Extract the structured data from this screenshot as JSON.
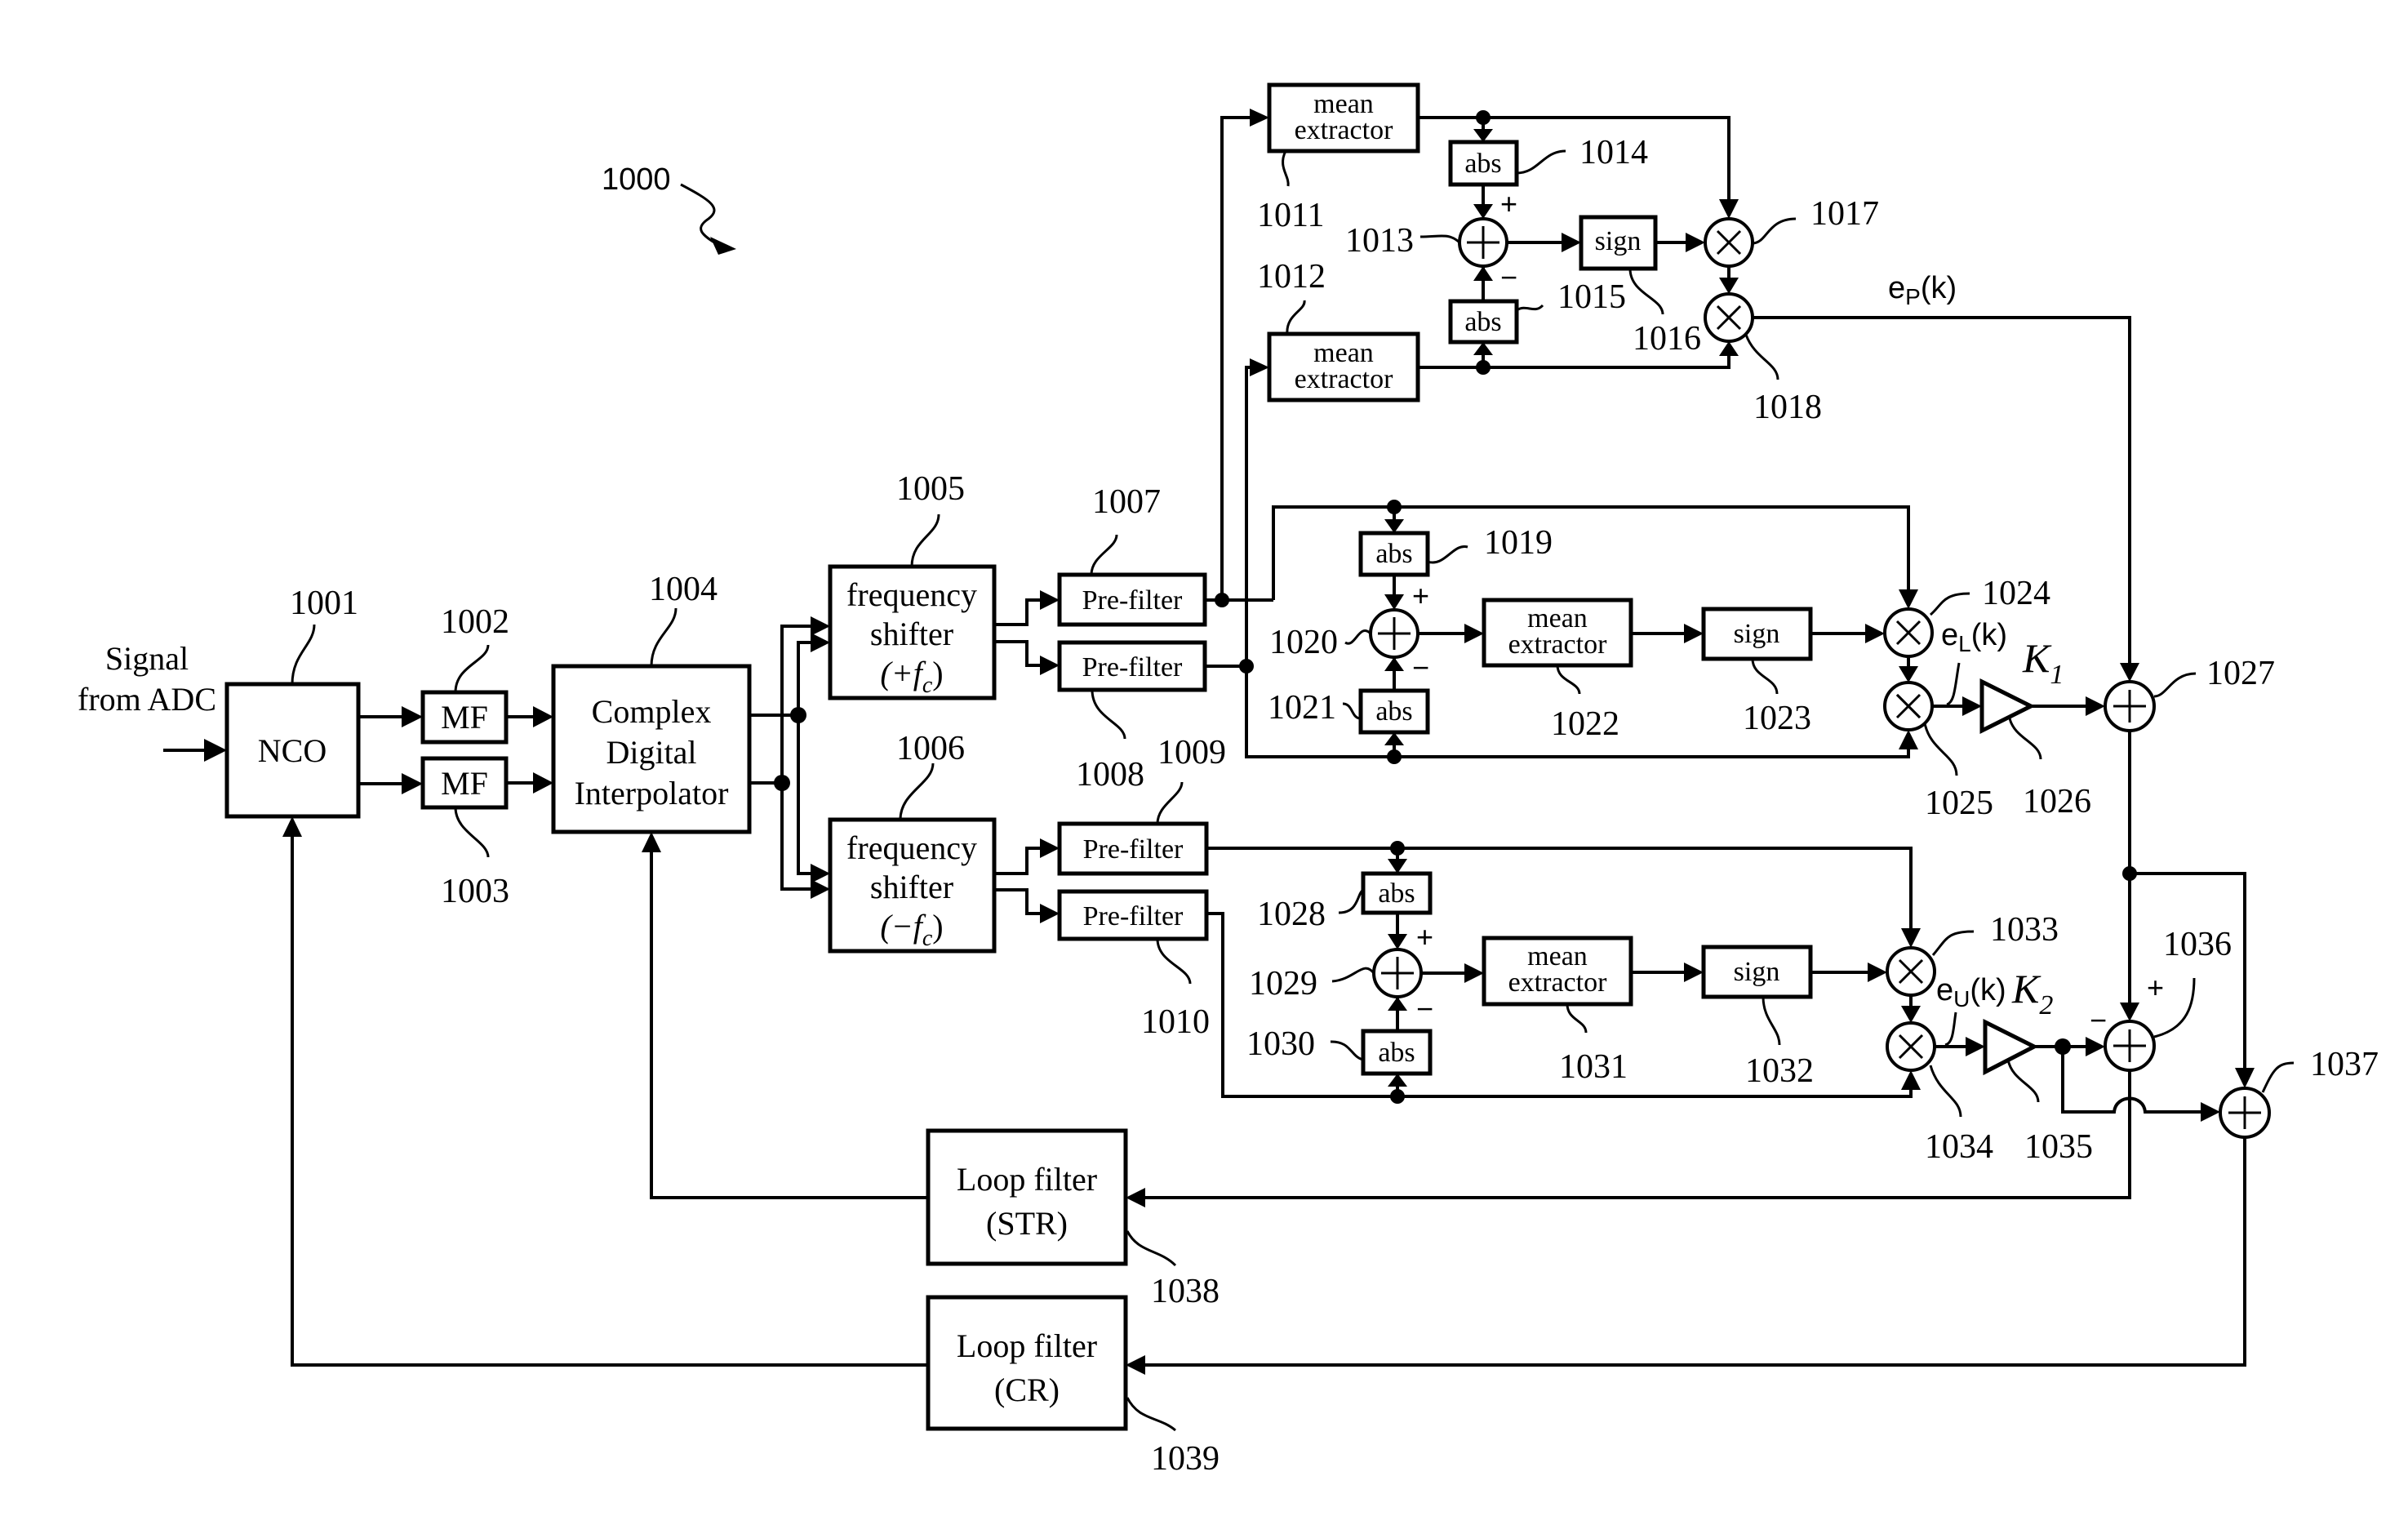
{
  "figure": {
    "id_label": "1000",
    "input_label_line1": "Signal",
    "input_label_line2": "from ADC"
  },
  "blocks": {
    "nco": {
      "ref": "1001",
      "label": "NCO"
    },
    "mf_top": {
      "ref": "1002",
      "label": "MF"
    },
    "mf_bottom": {
      "ref": "1003",
      "label": "MF"
    },
    "interpolator": {
      "ref": "1004",
      "line1": "Complex",
      "line2": "Digital",
      "line3": "Interpolator"
    },
    "freq_shifter_pos": {
      "ref": "1005",
      "line1": "frequency",
      "line2": "shifter",
      "line3": "(+f",
      "sub": "c",
      "close": ")"
    },
    "freq_shifter_neg": {
      "ref": "1006",
      "line1": "frequency",
      "line2": "shifter",
      "line3": "(−f",
      "sub": "c",
      "close": ")"
    },
    "prefilter_1007": {
      "ref": "1007",
      "label": "Pre-filter"
    },
    "prefilter_1008": {
      "ref": "1008",
      "label": "Pre-filter"
    },
    "prefilter_1009": {
      "ref": "1009",
      "label": "Pre-filter"
    },
    "prefilter_1010": {
      "ref": "1010",
      "label": "Pre-filter"
    },
    "mean_1011": {
      "ref": "1011",
      "line1": "mean",
      "line2": "extractor"
    },
    "mean_1012": {
      "ref": "1012",
      "line1": "mean",
      "line2": "extractor"
    },
    "adder_1013": {
      "ref": "1013"
    },
    "abs_1014": {
      "ref": "1014",
      "label": "abs"
    },
    "abs_1015": {
      "ref": "1015",
      "label": "abs"
    },
    "sign_1016": {
      "ref": "1016",
      "label": "sign"
    },
    "mult_1017": {
      "ref": "1017"
    },
    "mult_1018": {
      "ref": "1018"
    },
    "abs_1019": {
      "ref": "1019",
      "label": "abs"
    },
    "adder_1020": {
      "ref": "1020"
    },
    "abs_1021": {
      "ref": "1021",
      "label": "abs"
    },
    "mean_1022": {
      "ref": "1022",
      "line1": "mean",
      "line2": "extractor"
    },
    "sign_1023": {
      "ref": "1023",
      "label": "sign"
    },
    "mult_1024": {
      "ref": "1024"
    },
    "mult_1025": {
      "ref": "1025"
    },
    "amp_1026": {
      "ref": "1026"
    },
    "adder_1027": {
      "ref": "1027"
    },
    "abs_1028": {
      "ref": "1028",
      "label": "abs"
    },
    "adder_1029": {
      "ref": "1029"
    },
    "abs_1030": {
      "ref": "1030",
      "label": "abs"
    },
    "mean_1031": {
      "ref": "1031",
      "line1": "mean",
      "line2": "extractor"
    },
    "sign_1032": {
      "ref": "1032",
      "label": "sign"
    },
    "mult_1033": {
      "ref": "1033"
    },
    "mult_1034": {
      "ref": "1034"
    },
    "amp_1035": {
      "ref": "1035"
    },
    "adder_1036": {
      "ref": "1036"
    },
    "adder_1037": {
      "ref": "1037"
    },
    "loop_filter_str": {
      "ref": "1038",
      "line1": "Loop filter",
      "line2": "(STR)"
    },
    "loop_filter_cr": {
      "ref": "1039",
      "line1": "Loop filter",
      "line2": "(CR)"
    }
  },
  "signals": {
    "ep": {
      "base": "e",
      "sub": "P",
      "arg": "(k)"
    },
    "el": {
      "base": "e",
      "sub": "L",
      "arg": "(k)"
    },
    "eu": {
      "base": "e",
      "sub": "U",
      "arg": "(k)"
    },
    "k1": {
      "base": "K",
      "sub": "1"
    },
    "k2": {
      "base": "K",
      "sub": "2"
    }
  },
  "symbols": {
    "plus": "+",
    "minus": "−",
    "times": "×"
  }
}
